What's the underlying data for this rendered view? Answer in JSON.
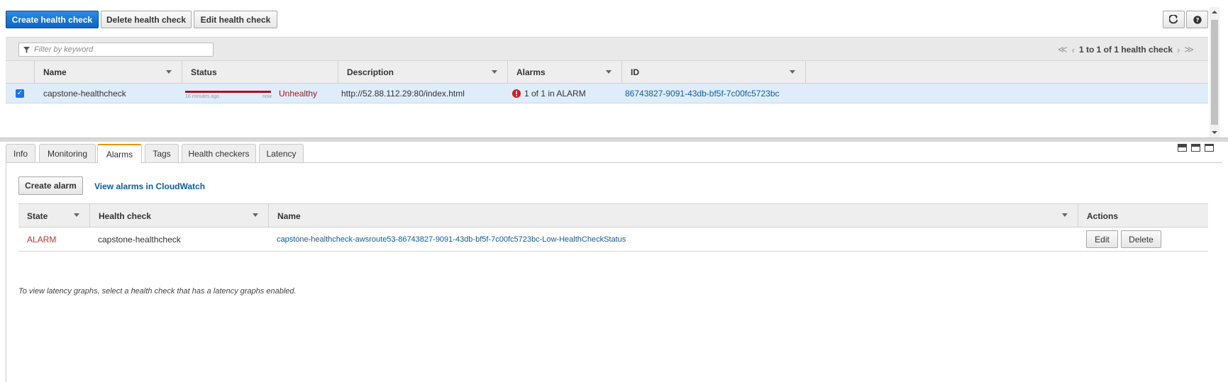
{
  "toolbar": {
    "create_label": "Create health check",
    "delete_label": "Delete health check",
    "edit_label": "Edit health check",
    "refresh_icon": "refresh-icon",
    "help_icon": "help-icon"
  },
  "filter": {
    "placeholder": "Filter by keyword"
  },
  "pager": {
    "text": "1 to 1 of 1 health check"
  },
  "columns": {
    "name": "Name",
    "status": "Status",
    "description": "Description",
    "alarms": "Alarms",
    "id": "ID"
  },
  "row": {
    "name": "capstone-healthcheck",
    "status_from": "16 minutes ago",
    "status_to": "now",
    "status": "Unhealthy",
    "description": "http://52.88.112.29:80/index.html",
    "alarms": "1 of 1 in ALARM",
    "id": "86743827-9091-43db-bf5f-7c00fc5723bc"
  },
  "tabs": {
    "info": "Info",
    "monitoring": "Monitoring",
    "alarms": "Alarms",
    "tags": "Tags",
    "health_checkers": "Health checkers",
    "latency": "Latency"
  },
  "alarms_panel": {
    "create_label": "Create alarm",
    "view_link": "View alarms in CloudWatch",
    "columns": {
      "state": "State",
      "health_check": "Health check",
      "name": "Name",
      "actions": "Actions"
    },
    "row": {
      "state": "ALARM",
      "health_check": "capstone-healthcheck",
      "name": "capstone-healthcheck-awsroute53-86743827-9091-43db-bf5f-7c00fc5723bc-Low-HealthCheckStatus",
      "edit": "Edit",
      "delete": "Delete"
    }
  },
  "latency_note": "To view latency graphs, select a health check that has a latency graphs enabled.",
  "colors": {
    "primary": "#1a6fd1",
    "unhealthy": "#b0171f",
    "link": "#0b5fb3",
    "tab_accent": "#e8940c"
  }
}
